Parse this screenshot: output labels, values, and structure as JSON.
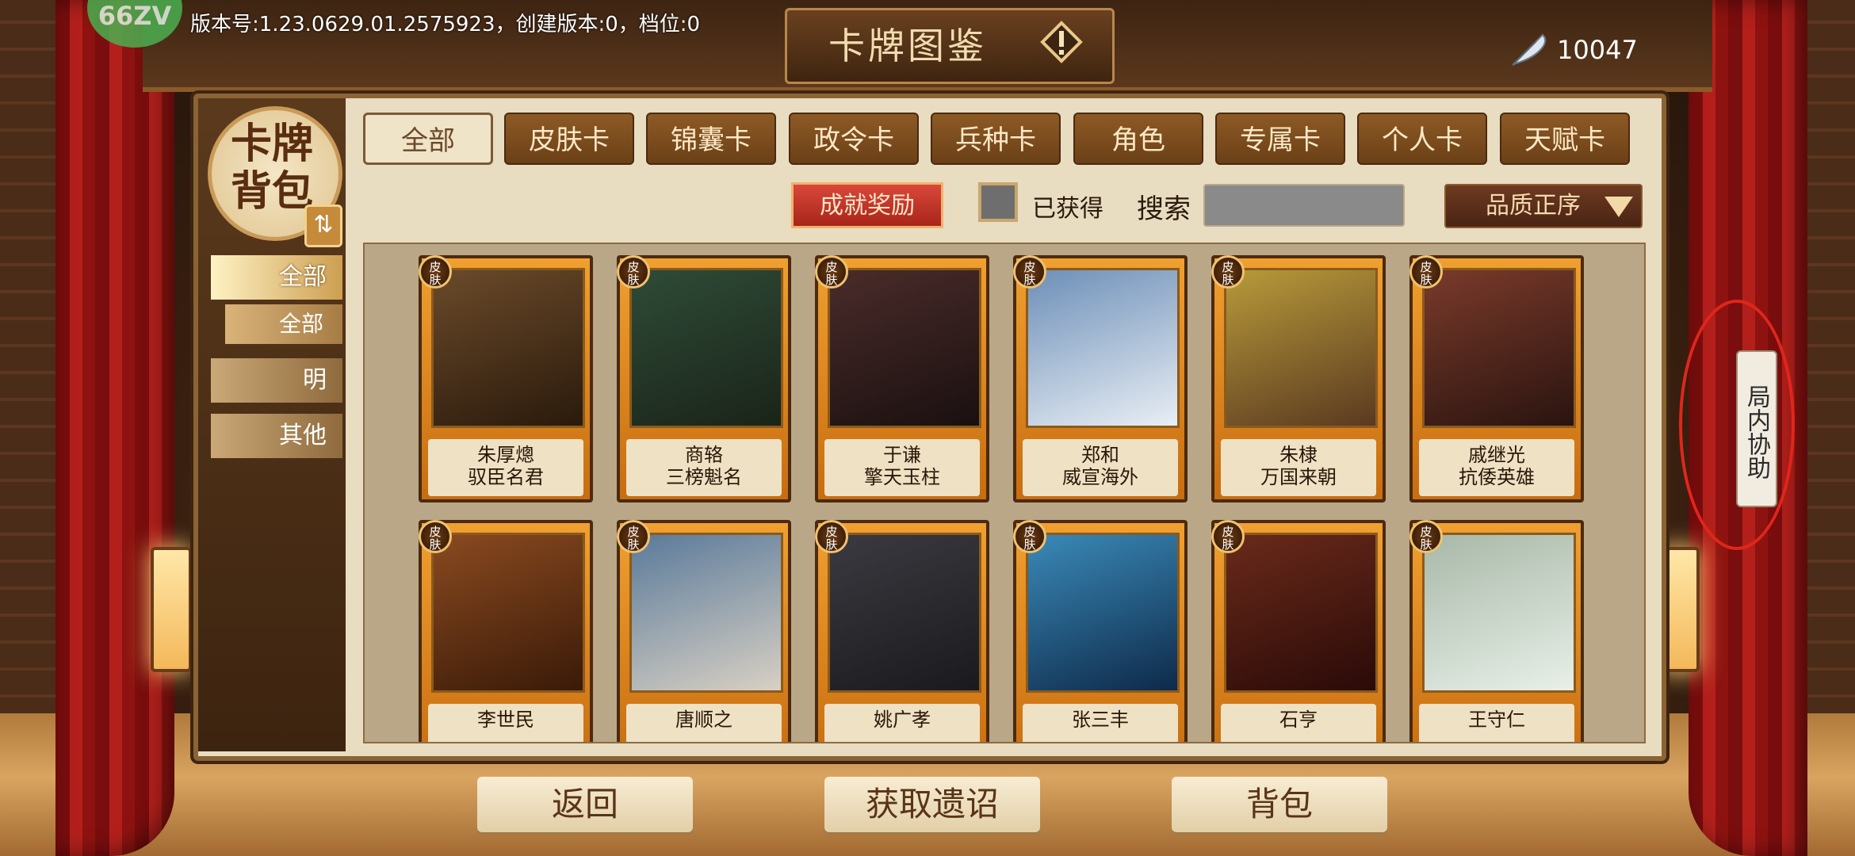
{
  "header": {
    "version_text": "版本号:1.23.0629.01.2575923，创建版本:0，档位:0",
    "title": "卡牌图鉴",
    "currency_amount": "10047",
    "logo_text": "66ZV"
  },
  "sidebar": {
    "seal_text": "卡牌背包",
    "items": [
      {
        "label": "全部",
        "state": "active"
      },
      {
        "label": "全部",
        "state": "sub"
      },
      {
        "label": "明",
        "state": "normal"
      },
      {
        "label": "其他",
        "state": "normal"
      }
    ]
  },
  "tabs": [
    "全部",
    "皮肤卡",
    "锦囊卡",
    "政令卡",
    "兵种卡",
    "角色",
    "专属卡",
    "个人卡",
    "天赋卡"
  ],
  "active_tab": "全部",
  "filters": {
    "achievement_button": "成就奖励",
    "owned_checkbox_label": "已获得",
    "owned_checked": false,
    "search_label": "搜索",
    "search_value": "",
    "sort_label": "品质正序"
  },
  "cards": [
    {
      "badge": "皮肤",
      "name": "朱厚熜",
      "title": "驭臣名君",
      "art_color": "#6b4a2a"
    },
    {
      "badge": "皮肤",
      "name": "商辂",
      "title": "三榜魁名",
      "art_color": "#2f4b38"
    },
    {
      "badge": "皮肤",
      "name": "于谦",
      "title": "擎天玉柱",
      "art_color": "#4a2c2a"
    },
    {
      "badge": "皮肤",
      "name": "郑和",
      "title": "威宣海外",
      "art_color": "#6d8fb8"
    },
    {
      "badge": "皮肤",
      "name": "朱棣",
      "title": "万国来朝",
      "art_color": "#b89a3a"
    },
    {
      "badge": "皮肤",
      "name": "戚继光",
      "title": "抗倭英雄",
      "art_color": "#7a3a2a"
    },
    {
      "badge": "皮肤",
      "name": "李世民",
      "title": "",
      "art_color": "#8a4a20"
    },
    {
      "badge": "皮肤",
      "name": "唐顺之",
      "title": "",
      "art_color": "#5a7a9a"
    },
    {
      "badge": "皮肤",
      "name": "姚广孝",
      "title": "",
      "art_color": "#3a3a40"
    },
    {
      "badge": "皮肤",
      "name": "张三丰",
      "title": "",
      "art_color": "#3a8ab8"
    },
    {
      "badge": "皮肤",
      "name": "石亨",
      "title": "",
      "art_color": "#6a2a1a"
    },
    {
      "badge": "皮肤",
      "name": "王守仁",
      "title": "",
      "art_color": "#a8b8a8"
    }
  ],
  "bottom_buttons": [
    "返回",
    "获取遗诏",
    "背包"
  ],
  "assist_tab": "局内协助",
  "colors": {
    "accent_orange": "#f0a030",
    "achievement_red": "#c8352a",
    "annotation_red": "#e0261b"
  }
}
